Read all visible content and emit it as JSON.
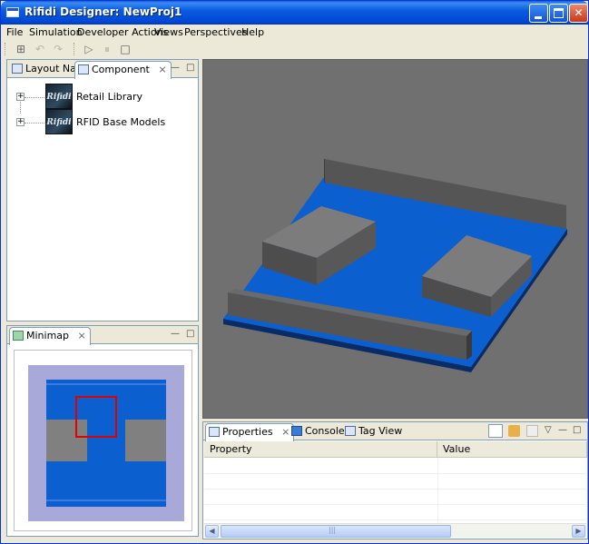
{
  "window": {
    "title": "Rifidi Designer: NewProj1",
    "minimize_label": "_",
    "maximize_label": "□",
    "close_label": "✕"
  },
  "menu": [
    "File",
    "Simulation",
    "Developer Actions",
    "Views",
    "Perspectives",
    "Help"
  ],
  "toolbar": {
    "icons": [
      "grid-icon",
      "undo-icon",
      "redo-icon",
      "play-icon",
      "pause-icon",
      "stop-icon"
    ],
    "glyphs": [
      "⊞",
      "↶",
      "↷",
      "▷",
      "⏸",
      "□"
    ]
  },
  "left_top_panel": {
    "tabs": [
      {
        "label": "Layout Nav",
        "active": false
      },
      {
        "label": "Component",
        "active": true,
        "close": "⨯"
      }
    ],
    "tree": [
      {
        "expander": "+",
        "logo_text": "Rifidi",
        "label": "Retail Library"
      },
      {
        "expander": "+",
        "logo_text": "Rifidi",
        "label": "RFID Base Models"
      }
    ],
    "min_glyph": "—",
    "max_glyph": "□"
  },
  "minimap_panel": {
    "tab_label": "Minimap",
    "close": "⨯",
    "min_glyph": "—",
    "max_glyph": "□"
  },
  "bottom_panel": {
    "tabs": [
      {
        "label": "Properties",
        "active": true,
        "close": "⨯"
      },
      {
        "label": "Console",
        "active": false
      },
      {
        "label": "Tag View",
        "active": false
      }
    ],
    "columns": [
      "Property",
      "Value"
    ],
    "scroll_thumb_mark": "|||",
    "scroll_left": "◀",
    "scroll_right": "▶",
    "toolbar_glyphs": {
      "menu": "▽",
      "min": "—",
      "max": "□"
    }
  },
  "colors": {
    "floor_blue": "#0c5fcf",
    "box_gray": "#7c7c7c",
    "viewport_bg": "#707070",
    "minimap_border": "#a8a9d9",
    "minimap_highlight": "#e00000"
  }
}
